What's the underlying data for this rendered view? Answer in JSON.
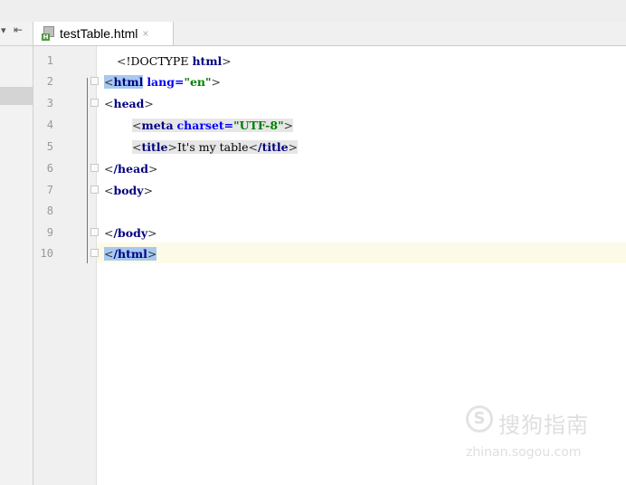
{
  "side_tools": {
    "arrow": "▾",
    "collapse": "⇤"
  },
  "tab": {
    "title": "testTable.html",
    "close": "×",
    "file_badge": "H"
  },
  "editor": {
    "lines": [
      {
        "n": "1",
        "c": "<!DOCTYPE html>"
      },
      {
        "n": "2",
        "c": "<html lang=\"en\">"
      },
      {
        "n": "3",
        "c": "<head>"
      },
      {
        "n": "4",
        "c": "<meta charset=\"UTF-8\">"
      },
      {
        "n": "5",
        "c": "<title>It's my table</title>"
      },
      {
        "n": "6",
        "c": "</head>"
      },
      {
        "n": "7",
        "c": "<body>"
      },
      {
        "n": "8",
        "c": ""
      },
      {
        "n": "9",
        "c": "</body>"
      },
      {
        "n": "10",
        "c": "</html>"
      }
    ]
  },
  "watermark": {
    "logo": "S",
    "text": "搜狗指南",
    "url": "zhinan.sogou.com"
  },
  "colors": {
    "tag": "#000080",
    "attr": "#0000ff",
    "value": "#008000",
    "current_line": "#fdfbe7",
    "selection": "#a6c9f0"
  }
}
